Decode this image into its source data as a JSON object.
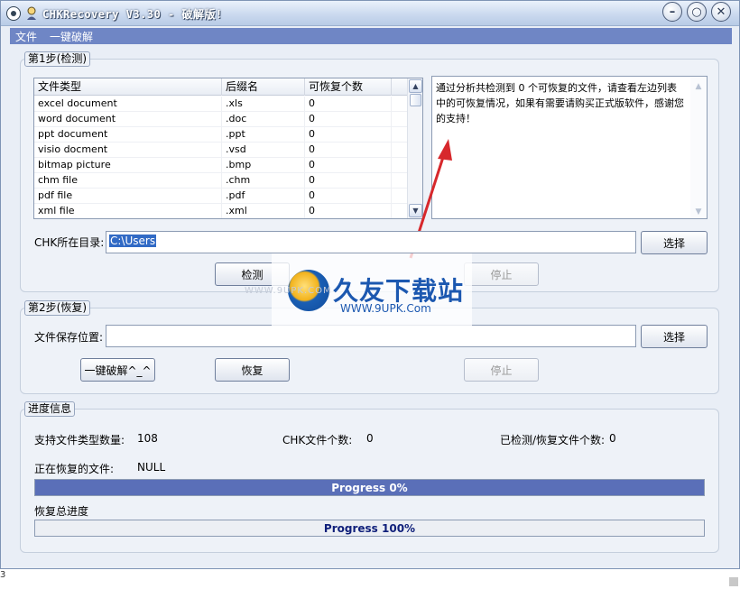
{
  "window": {
    "title": "CHKRecovery V3.30 - 破解版!",
    "buttons": {
      "minimize": "–",
      "restore": "○",
      "close": "✕"
    }
  },
  "menu": [
    "文件",
    "一键破解"
  ],
  "step1": {
    "label": "第1步(检测)",
    "columns": [
      "文件类型",
      "后缀名",
      "可恢复个数"
    ],
    "rows": [
      [
        "excel document",
        ".xls",
        "0"
      ],
      [
        "word document",
        ".doc",
        "0"
      ],
      [
        "ppt document",
        ".ppt",
        "0"
      ],
      [
        "visio docment",
        ".vsd",
        "0"
      ],
      [
        "bitmap picture",
        ".bmp",
        "0"
      ],
      [
        "chm file",
        ".chm",
        "0"
      ],
      [
        "pdf file",
        ".pdf",
        "0"
      ],
      [
        "xml file",
        ".xml",
        "0"
      ]
    ],
    "info_text": "通过分析共检测到 0 个可恢复的文件，请查看左边列表中的可恢复情况，如果有需要请购买正式版软件，感谢您的支持！",
    "dir_label": "CHK所在目录:",
    "dir_value": "C:\\Users",
    "select_btn": "选择",
    "detect_btn": "检测",
    "stop_btn": "停止"
  },
  "step2": {
    "label": "第2步(恢复)",
    "save_label": "文件保存位置:",
    "save_value": "",
    "select_btn": "选择",
    "crack_btn": "一键破解^_^",
    "restore_btn": "恢复",
    "stop_btn": "停止"
  },
  "progress": {
    "label": "进度信息",
    "supported_label": "支持文件类型数量:",
    "supported_value": "108",
    "chk_label": "CHK文件个数:",
    "chk_value": "0",
    "checked_label": "已检测/恢复文件个数:",
    "checked_value": "0",
    "current_label": "正在恢复的文件:",
    "current_value": "NULL",
    "bar1_text": "Progress 0%",
    "bar1_fraction": 0,
    "total_label": "恢复总进度",
    "bar2_text": "Progress 100%",
    "bar2_fraction": 1.0
  },
  "watermark": {
    "title": "久友下载站",
    "url": "WWW.9UPK.Com",
    "faint": "WWW.9UPK.COM"
  },
  "footer": {
    "corner_text": "3"
  },
  "colors": {
    "menubar": "#6f86c5",
    "bar1_fill": "#5a6fb8",
    "bar1_text": "#ffffff",
    "bar2_text": "#0f1f7a"
  }
}
